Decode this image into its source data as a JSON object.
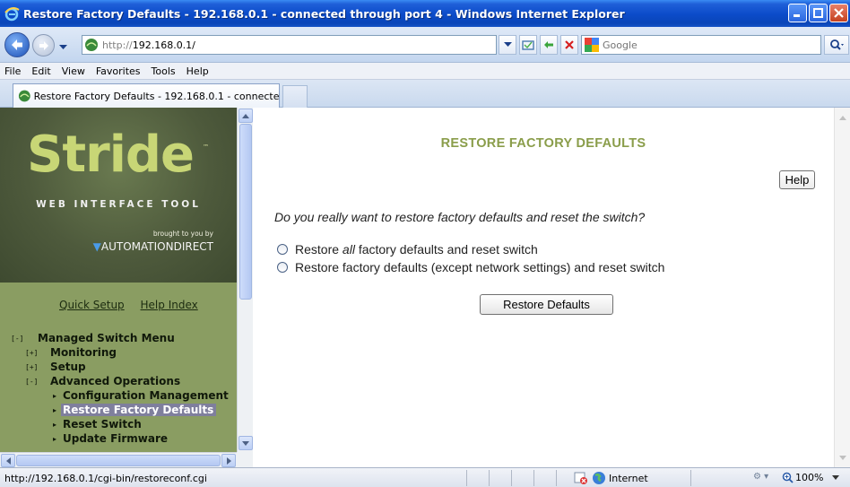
{
  "window": {
    "title": "Restore Factory Defaults - 192.168.0.1 - connected through port 4 - Windows Internet Explorer"
  },
  "address_bar": {
    "url_protocol": "http://",
    "url_host": "192.168.0.1/",
    "search_placeholder": "Google"
  },
  "menu": [
    "File",
    "Edit",
    "View",
    "Favorites",
    "Tools",
    "Help"
  ],
  "tab": {
    "title": "Restore Factory Defaults - 192.168.0.1 - connected t..."
  },
  "sidebar": {
    "logo_text": "Stride",
    "logo_tm": "™",
    "tagline": "WEB INTERFACE TOOL",
    "brought_by": "brought to you by",
    "brand": "AUTOMATIONDIRECT",
    "links": [
      "Quick Setup",
      "Help Index"
    ],
    "tree": [
      {
        "toggle": "[-]",
        "label": "Managed Switch Menu",
        "level": 0
      },
      {
        "toggle": "[+]",
        "label": "Monitoring",
        "level": 1
      },
      {
        "toggle": "[+]",
        "label": "Setup",
        "level": 1
      },
      {
        "toggle": "[-]",
        "label": "Advanced Operations",
        "level": 1
      },
      {
        "toggle": "▸",
        "label": "Configuration Management",
        "level": 2
      },
      {
        "toggle": "▸",
        "label": "Restore Factory Defaults",
        "level": 2,
        "selected": true
      },
      {
        "toggle": "▸",
        "label": "Reset Switch",
        "level": 2
      },
      {
        "toggle": "▸",
        "label": "Update Firmware",
        "level": 2
      }
    ]
  },
  "main": {
    "title": "RESTORE FACTORY DEFAULTS",
    "help_label": "Help",
    "question": "Do you really want to restore factory defaults and reset the switch?",
    "option1_pre": "Restore ",
    "option1_em": "all",
    "option1_post": " factory defaults and reset switch",
    "option2": "Restore factory defaults (except network settings) and reset switch",
    "restore_button": "Restore Defaults"
  },
  "status": {
    "url": "http://192.168.0.1/cgi-bin/restoreconf.cgi",
    "zone": "Internet",
    "zoom": "100%"
  },
  "colors": {
    "title_accent": "#8a9d4a",
    "sidebar_bg": "#8a9d62",
    "selected_bg": "#7f7f9d"
  }
}
